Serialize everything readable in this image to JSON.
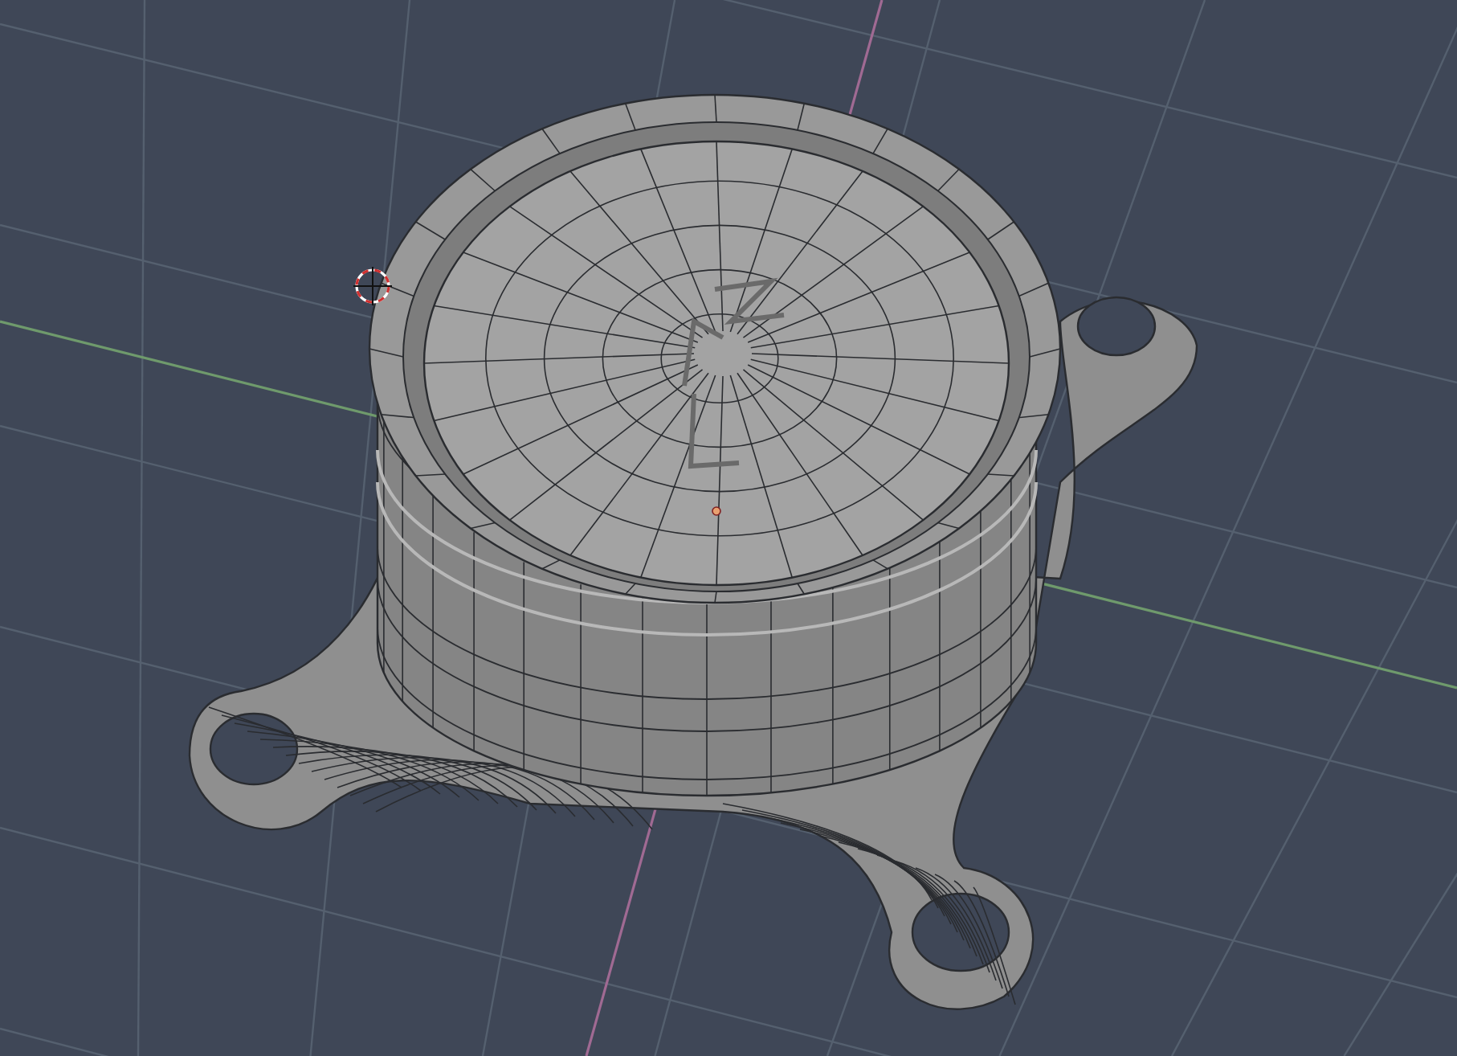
{
  "viewport": {
    "overlays": [
      {
        "kind": "grid"
      },
      {
        "kind": "axis-x"
      },
      {
        "kind": "axis-y"
      },
      {
        "kind": "cursor"
      },
      {
        "kind": "origin"
      }
    ],
    "objects": [
      {
        "kind": "mount-model",
        "selected": false
      }
    ]
  }
}
